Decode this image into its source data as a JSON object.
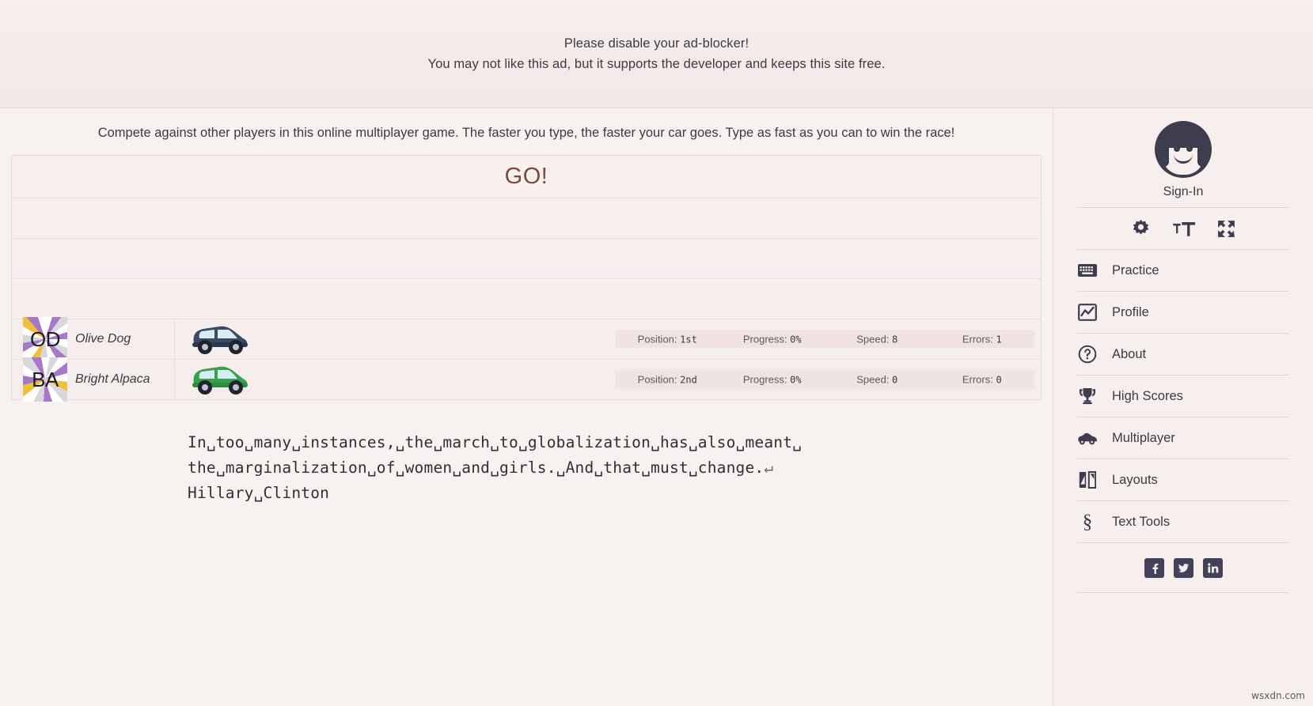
{
  "ad": {
    "line1": "Please disable your ad-blocker!",
    "line2": "You may not like this ad, but it supports the developer and keeps this site free."
  },
  "main": {
    "intro": "Compete against other players in this online multiplayer game. The faster you type, the faster your car goes. Type as fast as you can to win the race!",
    "go_text": "GO!"
  },
  "racers": [
    {
      "initials": "OD",
      "name": "Olive Dog",
      "car_color": "#3c4a63",
      "stats": {
        "position_label": "Position:",
        "position_value": "1st",
        "progress_label": "Progress:",
        "progress_value": "0%",
        "speed_label": "Speed:",
        "speed_value": "8",
        "errors_label": "Errors:",
        "errors_value": "1"
      }
    },
    {
      "initials": "BA",
      "name": "Bright Alpaca",
      "car_color": "#3aa04a",
      "stats": {
        "position_label": "Position:",
        "position_value": "2nd",
        "progress_label": "Progress:",
        "progress_value": "0%",
        "speed_label": "Speed:",
        "speed_value": "0",
        "errors_label": "Errors:",
        "errors_value": "0"
      }
    }
  ],
  "quote": {
    "line1": "In␣too␣many␣instances,␣the␣march␣to␣globalization␣has␣also␣meant␣",
    "line2": "the␣marginalization␣of␣women␣and␣girls.␣And␣that␣must␣change.",
    "line2_return": "↵",
    "line3": "Hillary␣Clinton"
  },
  "sidebar": {
    "signin_label": "Sign-In",
    "avatar_icon": "user-avatar-icon",
    "tool_icons": [
      {
        "name": "gear-icon",
        "label": "Settings"
      },
      {
        "name": "text-size-icon",
        "label": "Text Size"
      },
      {
        "name": "fullscreen-icon",
        "label": "Fullscreen"
      }
    ],
    "menu": [
      {
        "label": "Practice",
        "icon": "keyboard-icon"
      },
      {
        "label": "Profile",
        "icon": "chart-line-icon"
      },
      {
        "label": "About",
        "icon": "question-circle-icon"
      },
      {
        "label": "High Scores",
        "icon": "trophy-icon"
      },
      {
        "label": "Multiplayer",
        "icon": "car-icon"
      },
      {
        "label": "Layouts",
        "icon": "layouts-icon"
      },
      {
        "label": "Text Tools",
        "icon": "section-sign-icon"
      }
    ],
    "social": [
      {
        "name": "facebook-icon",
        "label": "Facebook"
      },
      {
        "name": "twitter-icon",
        "label": "Twitter"
      },
      {
        "name": "linkedin-icon",
        "label": "LinkedIn"
      }
    ]
  },
  "watermark": "wsxdn.com"
}
